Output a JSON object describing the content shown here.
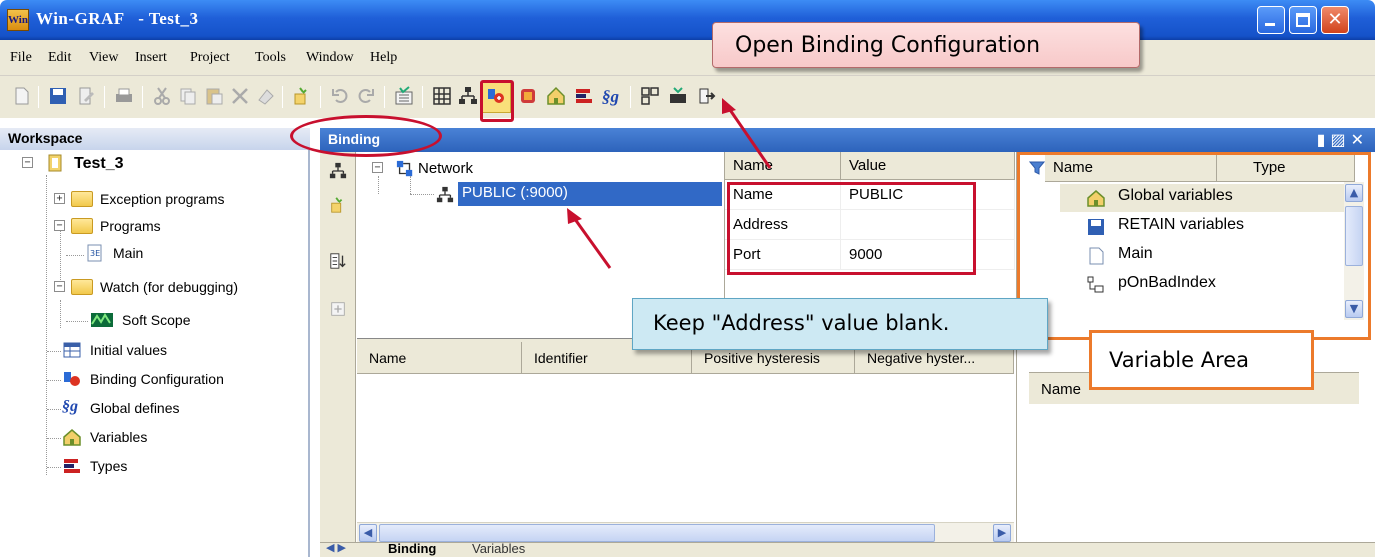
{
  "window": {
    "app": "Win-GRAF",
    "title": "Win-GRAF   - Test_3",
    "app_icon": "Win"
  },
  "menu": [
    "File",
    "Edit",
    "View",
    "Insert",
    "Project",
    "Tools",
    "Window",
    "Help"
  ],
  "workspace": {
    "title": "Workspace",
    "project": "Test_3",
    "items": {
      "exception": "Exception programs",
      "programs": "Programs",
      "main": "Main",
      "watch": "Watch (for debugging)",
      "scope": "Soft Scope",
      "initial": "Initial values",
      "binding": "Binding Configuration",
      "defines": "Global defines",
      "variables": "Variables",
      "types": "Types"
    }
  },
  "binding_panel": {
    "title": "Binding",
    "tree": {
      "root": "Network",
      "public": "PUBLIC (:9000)"
    },
    "props_headers": {
      "name": "Name",
      "value": "Value"
    },
    "props": [
      {
        "name": "Name",
        "value": "PUBLIC"
      },
      {
        "name": "Address",
        "value": ""
      },
      {
        "name": "Port",
        "value": "9000"
      }
    ],
    "list_headers": [
      "Name",
      "Identifier",
      "Positive hysteresis",
      "Negative hyster..."
    ],
    "list_header_right": "Name"
  },
  "variables_panel": {
    "headers": {
      "name": "Name",
      "type": "Type"
    },
    "rows": [
      "Global variables",
      "RETAIN variables",
      "Main",
      "pOnBadIndex"
    ]
  },
  "bottom_tabs": [
    "Binding",
    "Variables"
  ],
  "callouts": {
    "open_binding": "Open Binding Configuration",
    "address_note": "Keep \"Address\" value blank.",
    "variable_area": "Variable Area"
  },
  "colors": {
    "annotation_red": "#c8102e",
    "annotation_orange": "#ec7a2b",
    "selection": "#3169c6"
  }
}
